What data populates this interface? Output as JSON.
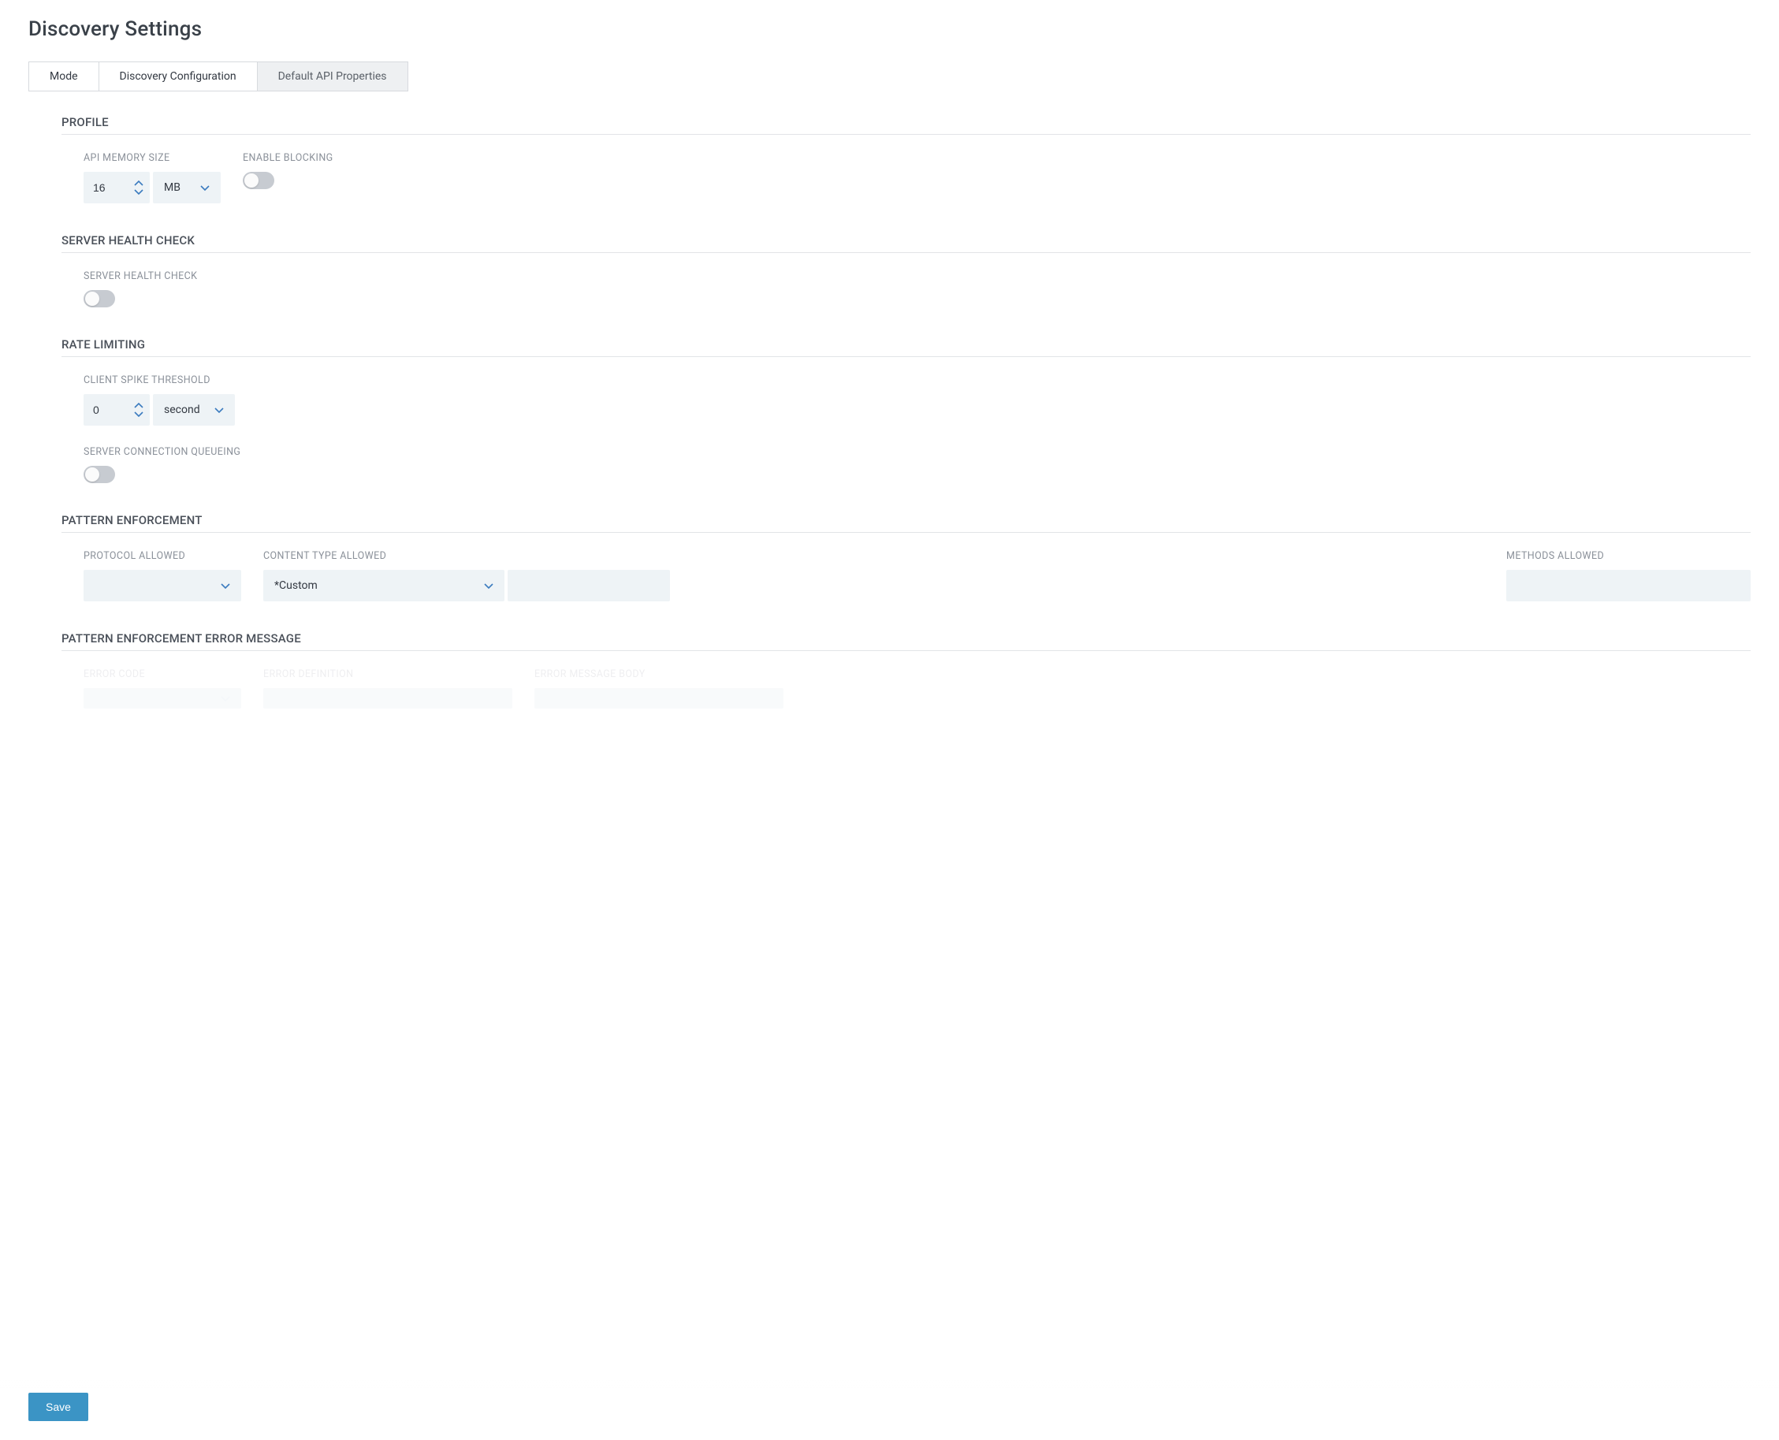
{
  "page": {
    "title": "Discovery Settings"
  },
  "tabs": {
    "mode": {
      "label": "Mode"
    },
    "config": {
      "label": "Discovery Configuration"
    },
    "props": {
      "label": "Default API Properties"
    }
  },
  "sections": {
    "profile": {
      "title": "PROFILE",
      "apiMemorySize": {
        "label": "API MEMORY SIZE",
        "value": "16",
        "unit": "MB"
      },
      "enableBlocking": {
        "label": "ENABLE BLOCKING",
        "on": false
      }
    },
    "serverHealth": {
      "title": "SERVER HEALTH CHECK",
      "serverHealthCheck": {
        "label": "SERVER HEALTH CHECK",
        "on": false
      }
    },
    "rateLimiting": {
      "title": "RATE LIMITING",
      "clientSpike": {
        "label": "CLIENT SPIKE THRESHOLD",
        "value": "0",
        "unit": "second"
      },
      "serverQueue": {
        "label": "SERVER CONNECTION QUEUEING",
        "on": false
      }
    },
    "patternEnforcement": {
      "title": "PATTERN ENFORCEMENT",
      "protocol": {
        "label": "PROTOCOL ALLOWED",
        "value": ""
      },
      "contentType": {
        "label": "CONTENT TYPE ALLOWED",
        "value": "*Custom",
        "text": ""
      },
      "methods": {
        "label": "METHODS ALLOWED",
        "value": ""
      }
    },
    "patternErrorMsg": {
      "title": "PATTERN ENFORCEMENT ERROR MESSAGE",
      "errorCode": {
        "label": "ERROR CODE",
        "value": ""
      },
      "errorDef": {
        "label": "ERROR DEFINITION",
        "value": ""
      },
      "errorBody": {
        "label": "ERROR MESSAGE BODY",
        "value": ""
      }
    }
  },
  "actions": {
    "save": "Save"
  },
  "colors": {
    "accent": "#3b94c5",
    "fieldBg": "#eef3f6",
    "label": "#8a9099"
  }
}
